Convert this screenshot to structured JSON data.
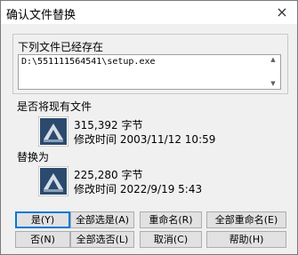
{
  "title": "确认文件替换",
  "close_icon": "×",
  "group": {
    "title": "下列文件已经存在",
    "path": "D:\\551111564541\\setup.exe",
    "scroll_up": "▲",
    "scroll_down": "▼"
  },
  "existing": {
    "label": "是否将现有文件",
    "size": "315,392 字节",
    "modified": "修改时间 2003/11/12 10:59"
  },
  "replacement": {
    "label": "替换为",
    "size": "225,280 字节",
    "modified": "修改时间 2022/9/19 5:43"
  },
  "buttons": {
    "yes": "是(Y)",
    "yes_all": "全部选是(A)",
    "rename": "重命名(R)",
    "rename_all": "全部重命名(E)",
    "no": "否(N)",
    "no_all": "全部选否(L)",
    "cancel": "取消(C)",
    "help": "帮助(H)"
  }
}
